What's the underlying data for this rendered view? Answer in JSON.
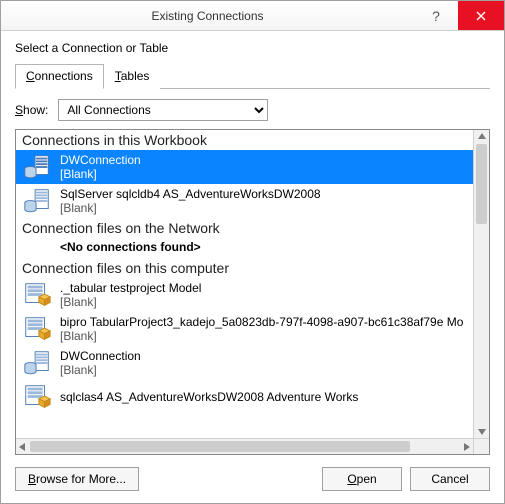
{
  "title": "Existing Connections",
  "prompt": "Select a Connection or Table",
  "tabs": {
    "connections": "Connections",
    "tables": "Tables"
  },
  "show_label": "Show:",
  "show_value": "All Connections",
  "groups": {
    "workbook": "Connections in this Workbook",
    "network": "Connection files on the Network",
    "computer": "Connection files on this computer"
  },
  "no_conn": "<No connections found>",
  "items": {
    "wb1": {
      "name": "DWConnection",
      "sub": "[Blank]"
    },
    "wb2": {
      "name": "SqlServer sqlcldb4 AS_AdventureWorksDW2008",
      "sub": "[Blank]"
    },
    "c1": {
      "name": "._tabular testproject Model",
      "sub": "[Blank]"
    },
    "c2": {
      "name": "bipro TabularProject3_kadejo_5a0823db-797f-4098-a907-bc61c38af79e Mo",
      "sub": "[Blank]"
    },
    "c3": {
      "name": "DWConnection",
      "sub": "[Blank]"
    },
    "c4": {
      "name": "sqlclas4 AS_AdventureWorksDW2008 Adventure Works"
    }
  },
  "buttons": {
    "browse": "Browse for More...",
    "open": "Open",
    "cancel": "Cancel"
  }
}
